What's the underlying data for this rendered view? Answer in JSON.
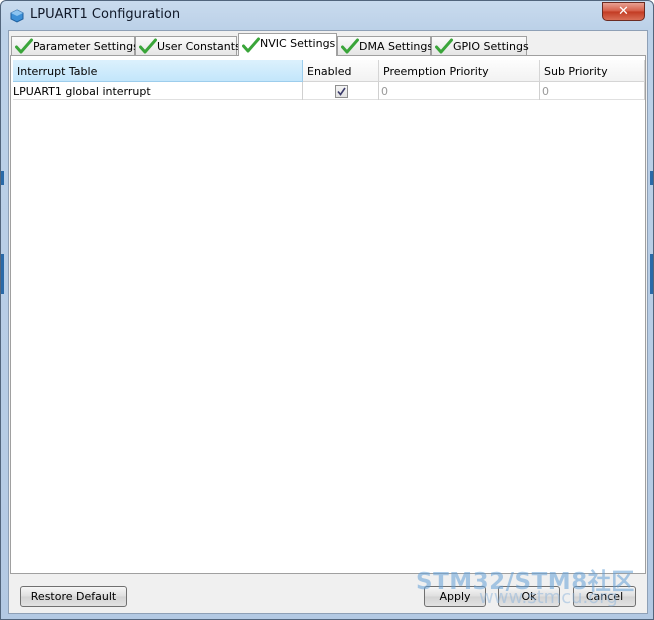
{
  "window": {
    "title": "LPUART1 Configuration",
    "close_label": "✕"
  },
  "tabs": [
    {
      "label": "Parameter Settings",
      "status": "valid"
    },
    {
      "label": "User Constants",
      "status": "valid"
    },
    {
      "label": "NVIC Settings",
      "status": "valid",
      "active": true
    },
    {
      "label": "DMA Settings",
      "status": "valid"
    },
    {
      "label": "GPIO Settings",
      "status": "valid"
    }
  ],
  "table": {
    "columns": [
      "Interrupt Table",
      "Enabled",
      "Preemption Priority",
      "Sub Priority"
    ],
    "rows": [
      {
        "name": "LPUART1 global interrupt",
        "enabled": true,
        "preemption": "0",
        "sub": "0"
      }
    ]
  },
  "buttons": {
    "restore_default": "Restore Default",
    "apply": "Apply",
    "ok": "Ok",
    "cancel": "Cancel"
  },
  "watermark": {
    "main": "STM32/STM8社区",
    "sub": "www.stmcu.org"
  },
  "colors": {
    "check_green": "#3aa53a",
    "header_selected": "#c3e6fb",
    "watermark": "#64a0d7"
  }
}
